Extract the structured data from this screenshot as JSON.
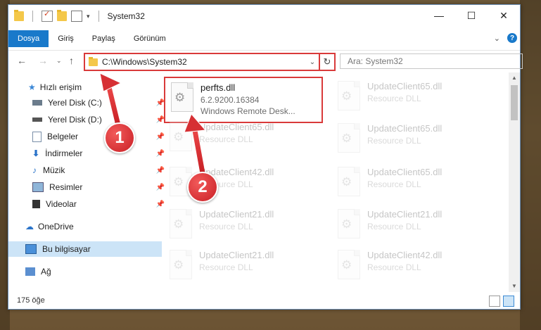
{
  "window": {
    "title": "System32"
  },
  "ribbon": {
    "tabs": [
      "Dosya",
      "Giriş",
      "Paylaş",
      "Görünüm"
    ]
  },
  "nav": {
    "address": "C:\\Windows\\System32",
    "search_placeholder": "Ara: System32"
  },
  "sidebar": {
    "items": [
      {
        "label": "Hızlı erişim",
        "pinned": false
      },
      {
        "label": "Yerel Disk (C:)",
        "pinned": true
      },
      {
        "label": "Yerel Disk (D:)",
        "pinned": true
      },
      {
        "label": "Belgeler",
        "pinned": true
      },
      {
        "label": "İndirmeler",
        "pinned": true
      },
      {
        "label": "Müzik",
        "pinned": true
      },
      {
        "label": "Resimler",
        "pinned": true
      },
      {
        "label": "Videolar",
        "pinned": true
      },
      {
        "label": "OneDrive",
        "pinned": false
      },
      {
        "label": "Bu bilgisayar",
        "pinned": false,
        "selected": true
      },
      {
        "label": "Ağ",
        "pinned": false
      }
    ]
  },
  "files": {
    "main": {
      "name": "perfts.dll",
      "version": "6.2.9200.16384",
      "description": "Windows Remote Desk..."
    },
    "left_column": [
      {
        "name": "UpdateClient65.dll",
        "type": "Resource DLL"
      },
      {
        "name": "UpdateClient42.dll",
        "type": "Resource DLL"
      },
      {
        "name": "UpdateClient21.dll",
        "type": "Resource DLL"
      },
      {
        "name": "UpdateClient21.dll",
        "type": "Resource DLL"
      }
    ],
    "right_column": [
      {
        "name": "UpdateClient65.dll",
        "type": "Resource DLL"
      },
      {
        "name": "UpdateClient65.dll",
        "type": "Resource DLL"
      },
      {
        "name": "UpdateClient65.dll",
        "type": "Resource DLL"
      },
      {
        "name": "UpdateClient21.dll",
        "type": "Resource DLL"
      },
      {
        "name": "UpdateClient42.dll",
        "type": "Resource DLL"
      }
    ]
  },
  "status": {
    "count": "175 öğe"
  },
  "callouts": [
    "1",
    "2"
  ],
  "colors": {
    "accent": "#1979ca",
    "highlight": "#d93a3a",
    "selected": "#cce4f7"
  }
}
